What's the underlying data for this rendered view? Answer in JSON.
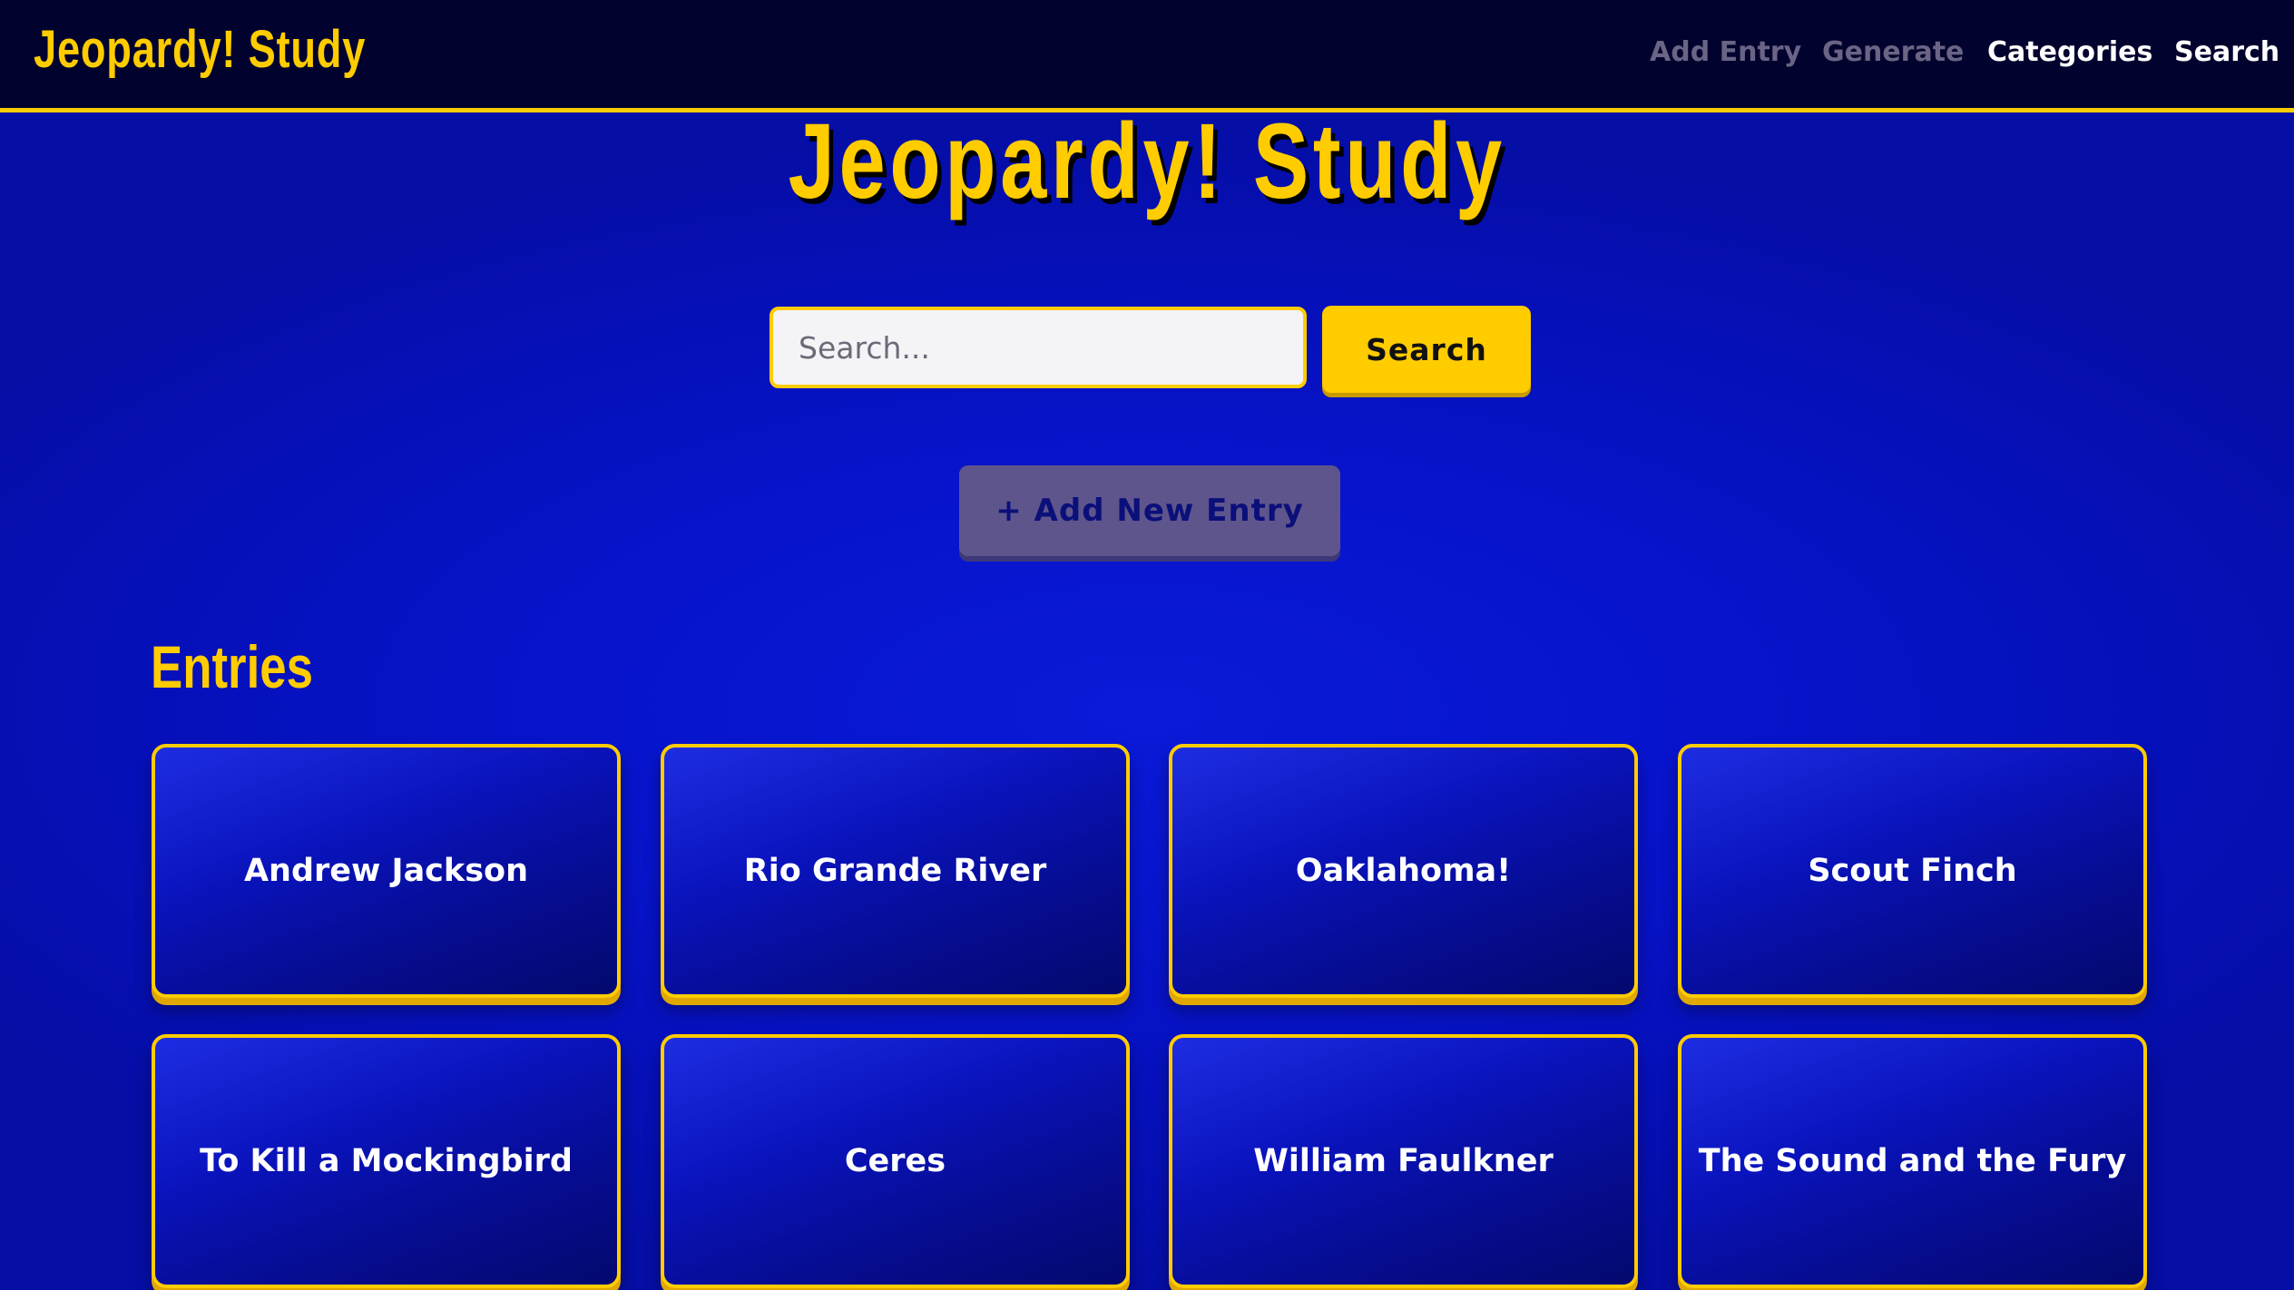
{
  "nav": {
    "brand": "Jeopardy! Study",
    "links": [
      "Add Entry",
      "Generate",
      "Categories",
      "Search"
    ]
  },
  "hero": {
    "title": "Jeopardy! Study"
  },
  "search": {
    "placeholder": "Search...",
    "button_label": "Search"
  },
  "add_entry_button": "+ Add New Entry",
  "entries": {
    "title": "Entries",
    "items": [
      "Andrew Jackson",
      "Rio Grande River",
      "Oaklahoma!",
      "Scout Finch",
      "To Kill a Mockingbird",
      "Ceres",
      "William Faulkner",
      "The Sound and the Fury"
    ]
  },
  "colors": {
    "accent": "#ffcc00",
    "background": "#0714cc",
    "navbar": "#01032e"
  }
}
